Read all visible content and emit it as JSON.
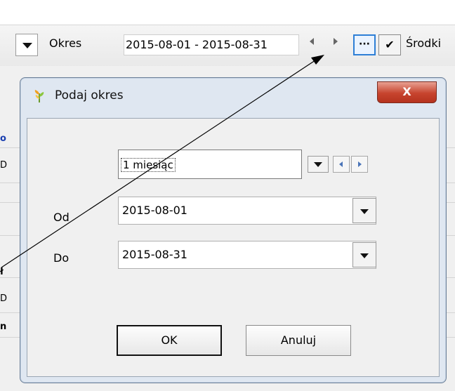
{
  "toolbar": {
    "okres_label": "Okres",
    "range_value": "2015-08-01 - 2015-08-31",
    "more_button": "···",
    "confirm_button": "✔",
    "srodki_label": "Środki"
  },
  "dialog": {
    "title": "Podaj okres",
    "close_glyph": "X",
    "period_select": "1 miesiąc",
    "od_label": "Od",
    "od_value": "2015-08-01",
    "do_label": "Do",
    "do_value": "2015-08-31",
    "ok_label": "OK",
    "cancel_label": "Anuluj"
  },
  "background_edge_text": {
    "c1": "o",
    "c2": "D",
    "c3": "ł",
    "c4": "D",
    "c5": "n"
  },
  "colors": {
    "accent": "#2e7fd6",
    "close": "#c7442e",
    "dialog_frame": "#dfe7f1"
  }
}
